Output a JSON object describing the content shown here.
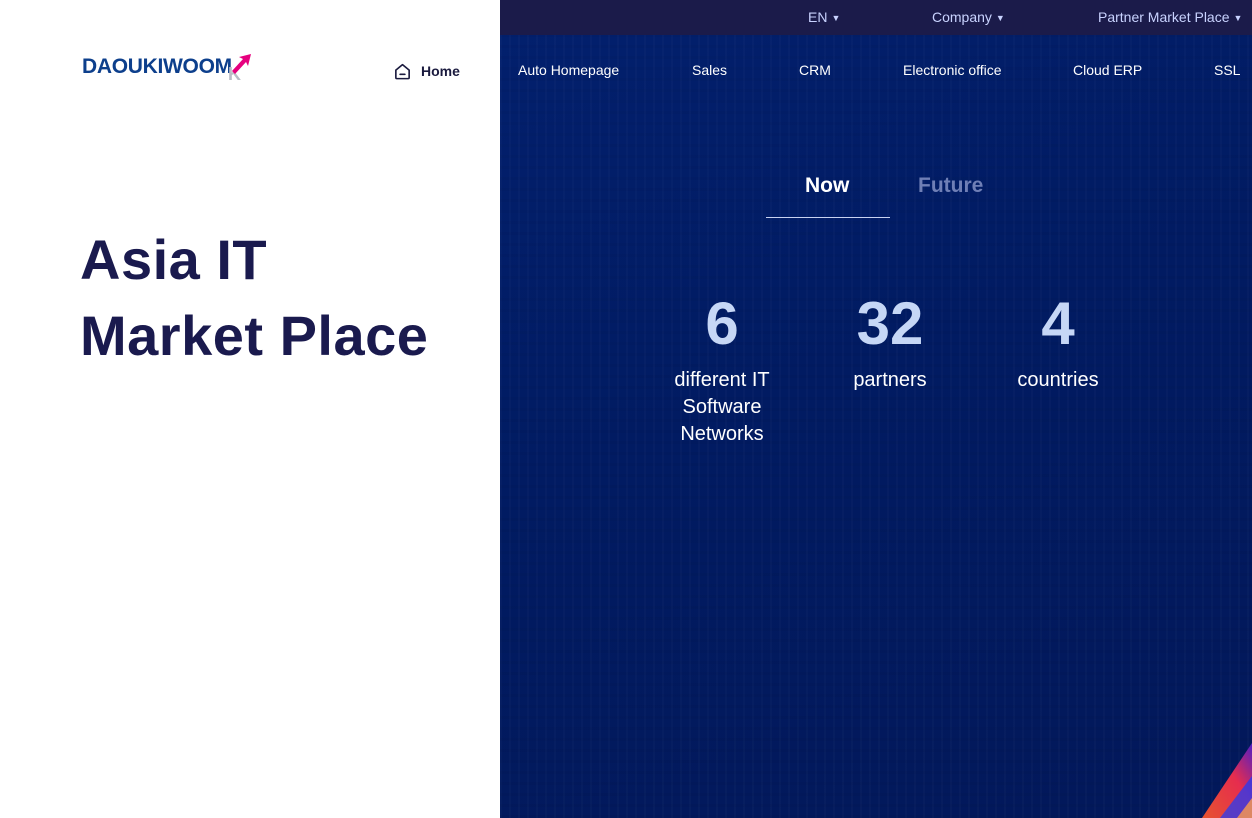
{
  "topbar": {
    "language": "EN",
    "company": "Company",
    "partner_market_place": "Partner Market Place"
  },
  "logo": {
    "text": "DAOUKIWOOM",
    "mark": "K",
    "brand_color": "#0d3f8c",
    "accent_color": "#e6007e"
  },
  "nav": {
    "home": "Home",
    "items": [
      "Auto Homepage",
      "Sales",
      "CRM",
      "Electronic office",
      "Cloud ERP",
      "SSL"
    ]
  },
  "hero": {
    "line1": "Asia IT",
    "line2": "Market Place"
  },
  "tabs": {
    "now": "Now",
    "future": "Future",
    "active": "Now"
  },
  "stats": [
    {
      "value": "6",
      "line1": "different IT",
      "line2": "Software",
      "line3": "Networks"
    },
    {
      "value": "32",
      "line1": "partners",
      "line2": "",
      "line3": ""
    },
    {
      "value": "4",
      "line1": "countries",
      "line2": "",
      "line3": ""
    }
  ],
  "colors": {
    "panel": "#011b62",
    "topbar": "#1b1b4a",
    "title": "#1a1a4e",
    "stat_number": "#c6d7f6"
  },
  "icons": {
    "home": "home-icon",
    "caret": "caret-down-icon"
  }
}
